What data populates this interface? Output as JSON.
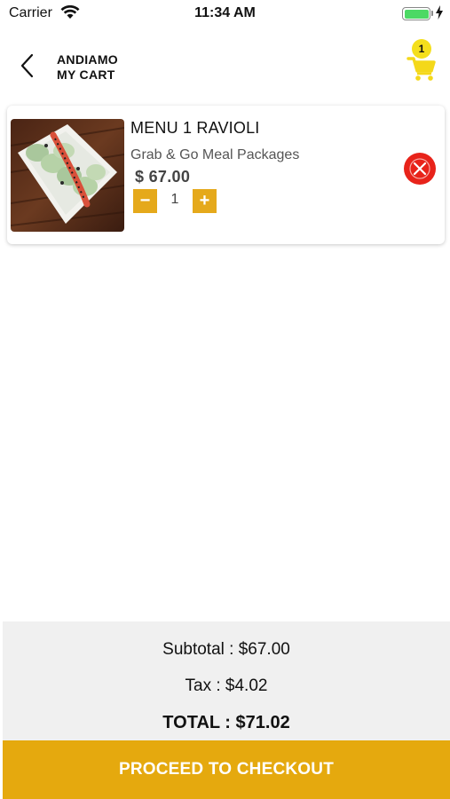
{
  "status_bar": {
    "carrier": "Carrier",
    "time": "11:34 AM",
    "battery_level": 1.0,
    "icons": [
      "wifi-icon",
      "battery-icon",
      "charging-bolt-icon"
    ]
  },
  "header": {
    "store_name": "ANDIAMO",
    "title": "MY CART",
    "back_icon": "chevron-left-icon",
    "cart_icon": "shopping-cart-icon",
    "cart_count": "1"
  },
  "cart_items": [
    {
      "name": "MENU 1 RAVIOLI",
      "category": "Grab & Go Meal Packages",
      "price": "$ 67.00",
      "quantity": "1",
      "minus_label": "−",
      "plus_label": "+",
      "remove_icon": "close-icon"
    }
  ],
  "summary": {
    "subtotal": "Subtotal : $67.00",
    "tax": "Tax : $4.02",
    "total": "TOTAL : $71.02"
  },
  "checkout": {
    "label": "PROCEED TO CHECKOUT"
  },
  "colors": {
    "accent": "#e5a91b",
    "checkout": "#e5a90e",
    "badge": "#f4df1c",
    "remove": "#e8231a",
    "battery": "#4cd964",
    "summary_bg": "#f0f0f0"
  }
}
